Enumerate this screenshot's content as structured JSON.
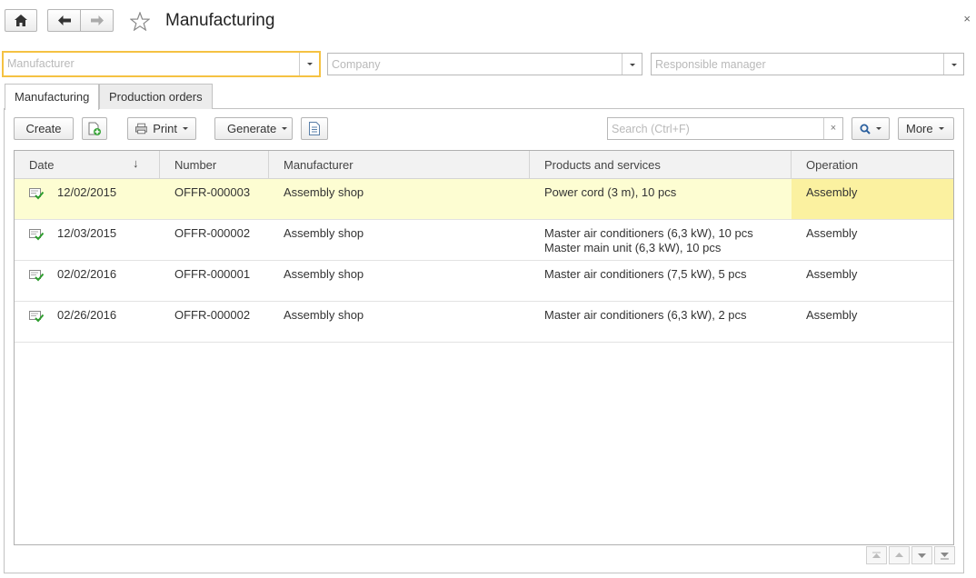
{
  "header": {
    "title": "Manufacturing",
    "close_glyph": "×"
  },
  "filters": {
    "manufacturer_placeholder": "Manufacturer",
    "company_placeholder": "Company",
    "manager_placeholder": "Responsible manager"
  },
  "tabs": [
    {
      "label": "Manufacturing",
      "selected": true
    },
    {
      "label": "Production orders",
      "selected": false
    }
  ],
  "toolbar": {
    "create_label": "Create",
    "print_label": "Print",
    "generate_label": "Generate",
    "search_placeholder": "Search (Ctrl+F)",
    "search_clear_glyph": "×",
    "more_label": "More"
  },
  "table": {
    "sort_glyph": "↓",
    "columns": [
      "Date",
      "Number",
      "Manufacturer",
      "Products and services",
      "Operation"
    ],
    "rows": [
      {
        "date": "12/02/2015",
        "number": "OFFR-000003",
        "manufacturer": "Assembly shop",
        "products": [
          "Power cord (3 m), 10 pcs"
        ],
        "operation": "Assembly",
        "selected": true
      },
      {
        "date": "12/03/2015",
        "number": "OFFR-000002",
        "manufacturer": "Assembly shop",
        "products": [
          "Master air conditioners (6,3 kW), 10 pcs",
          "Master main unit (6,3 kW), 10 pcs"
        ],
        "operation": "Assembly",
        "selected": false
      },
      {
        "date": "02/02/2016",
        "number": "OFFR-000001",
        "manufacturer": "Assembly shop",
        "products": [
          "Master air conditioners (7,5 kW), 5 pcs"
        ],
        "operation": "Assembly",
        "selected": false
      },
      {
        "date": "02/26/2016",
        "number": "OFFR-000002",
        "manufacturer": "Assembly shop",
        "products": [
          "Master air conditioners (6,3 kW), 2 pcs"
        ],
        "operation": "Assembly",
        "selected": false
      }
    ]
  },
  "colors": {
    "selected_row": "#fdfdd2",
    "selected_cell": "#fbf1a0",
    "focus_border": "#f5c242",
    "posted_check": "#2e9e2e"
  },
  "icons": [
    "home-icon",
    "back-arrow-icon",
    "forward-arrow-icon",
    "favorite-star-icon",
    "close-icon",
    "copy-add-icon",
    "printer-icon",
    "report-icon",
    "search-icon",
    "posted-document-icon",
    "scroll-top-icon",
    "scroll-page-up-icon",
    "scroll-page-down-icon",
    "scroll-bottom-icon"
  ]
}
